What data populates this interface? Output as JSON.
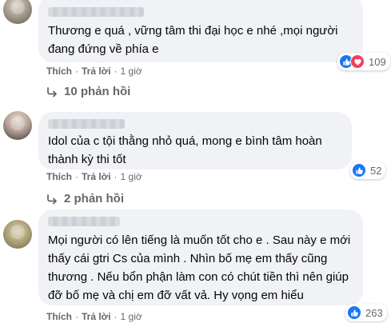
{
  "comments": [
    {
      "text": "Thương e quá , vững tâm thi đại học e nhé ,mọi người đang đứng về phía e",
      "actions": {
        "like": "Thích",
        "reply": "Trả lời",
        "time": "1 giờ"
      },
      "reactions": {
        "types": [
          "like-icon",
          "love-icon"
        ],
        "count": "109"
      },
      "replies_label": "10 phản hồi"
    },
    {
      "text": "Idol của c tội thằng nhỏ quá, mong e bình tâm hoàn thành kỳ thi tốt",
      "actions": {
        "like": "Thích",
        "reply": "Trả lời",
        "time": "1 giờ"
      },
      "reactions": {
        "types": [
          "like-icon"
        ],
        "count": "52"
      },
      "replies_label": "2 phản hồi"
    },
    {
      "text": "Mọi người có lên tiếng là muốn tốt cho e . Sau này e mới thấy cái gtri Cs của mình . Nhìn bố mẹ em thấy cũng thương . Nếu bổn phận làm con có chút tiền thì nên giúp đỡ bố mẹ và chị em đỡ vất vả. Hy vọng em hiểu",
      "actions": {
        "like": "Thích",
        "reply": "Trả lời",
        "time": "1 giờ"
      },
      "reactions": {
        "types": [
          "like-icon"
        ],
        "count": "263"
      }
    }
  ],
  "colors": {
    "like": "#1877f2",
    "love": "#f33e58",
    "bubble": "#f0f2f5",
    "meta": "#65676b"
  }
}
